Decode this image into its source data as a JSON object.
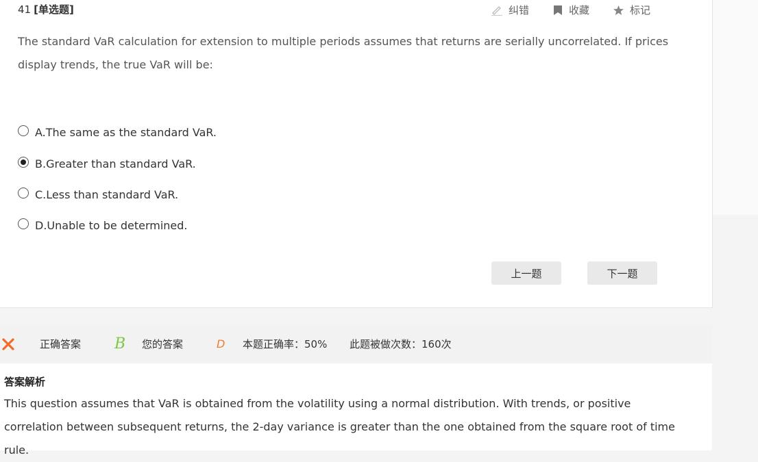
{
  "question": {
    "number": "41",
    "type": "[单选题]",
    "text": "The standard VaR calculation for extension to multiple periods assumes that returns are serially uncorrelated. If prices display trends, the true VaR will be:"
  },
  "tools": {
    "correct_label": "纠错",
    "favorite_label": "收藏",
    "mark_label": "标记"
  },
  "options": [
    {
      "label": "A.The same as the standard VaR.",
      "selected": false
    },
    {
      "label": "B.Greater than standard VaR.",
      "selected": true
    },
    {
      "label": "C.Less than standard VaR.",
      "selected": false
    },
    {
      "label": "D.Unable to be determined.",
      "selected": false
    }
  ],
  "nav": {
    "prev_label": "上一题",
    "next_label": "下一题"
  },
  "result": {
    "status_icon": "cross-icon",
    "correct_answer_label": "正确答案",
    "correct_answer_value": "B",
    "your_answer_label": "您的答案",
    "your_answer_value": "D",
    "accuracy_text": "本题正确率：50%",
    "attempts_text": "此题被做次数：160次"
  },
  "analysis": {
    "title": "答案解析",
    "text": "This question assumes that VaR is obtained from the volatility using a normal distribution. With trends, or positive correlation between subsequent returns, the 2-day variance is greater than the one obtained from the square root of time rule."
  },
  "colors": {
    "wrong": "#f26b2a",
    "correct_letter": "#7ac943",
    "your_letter": "#f07d31"
  }
}
